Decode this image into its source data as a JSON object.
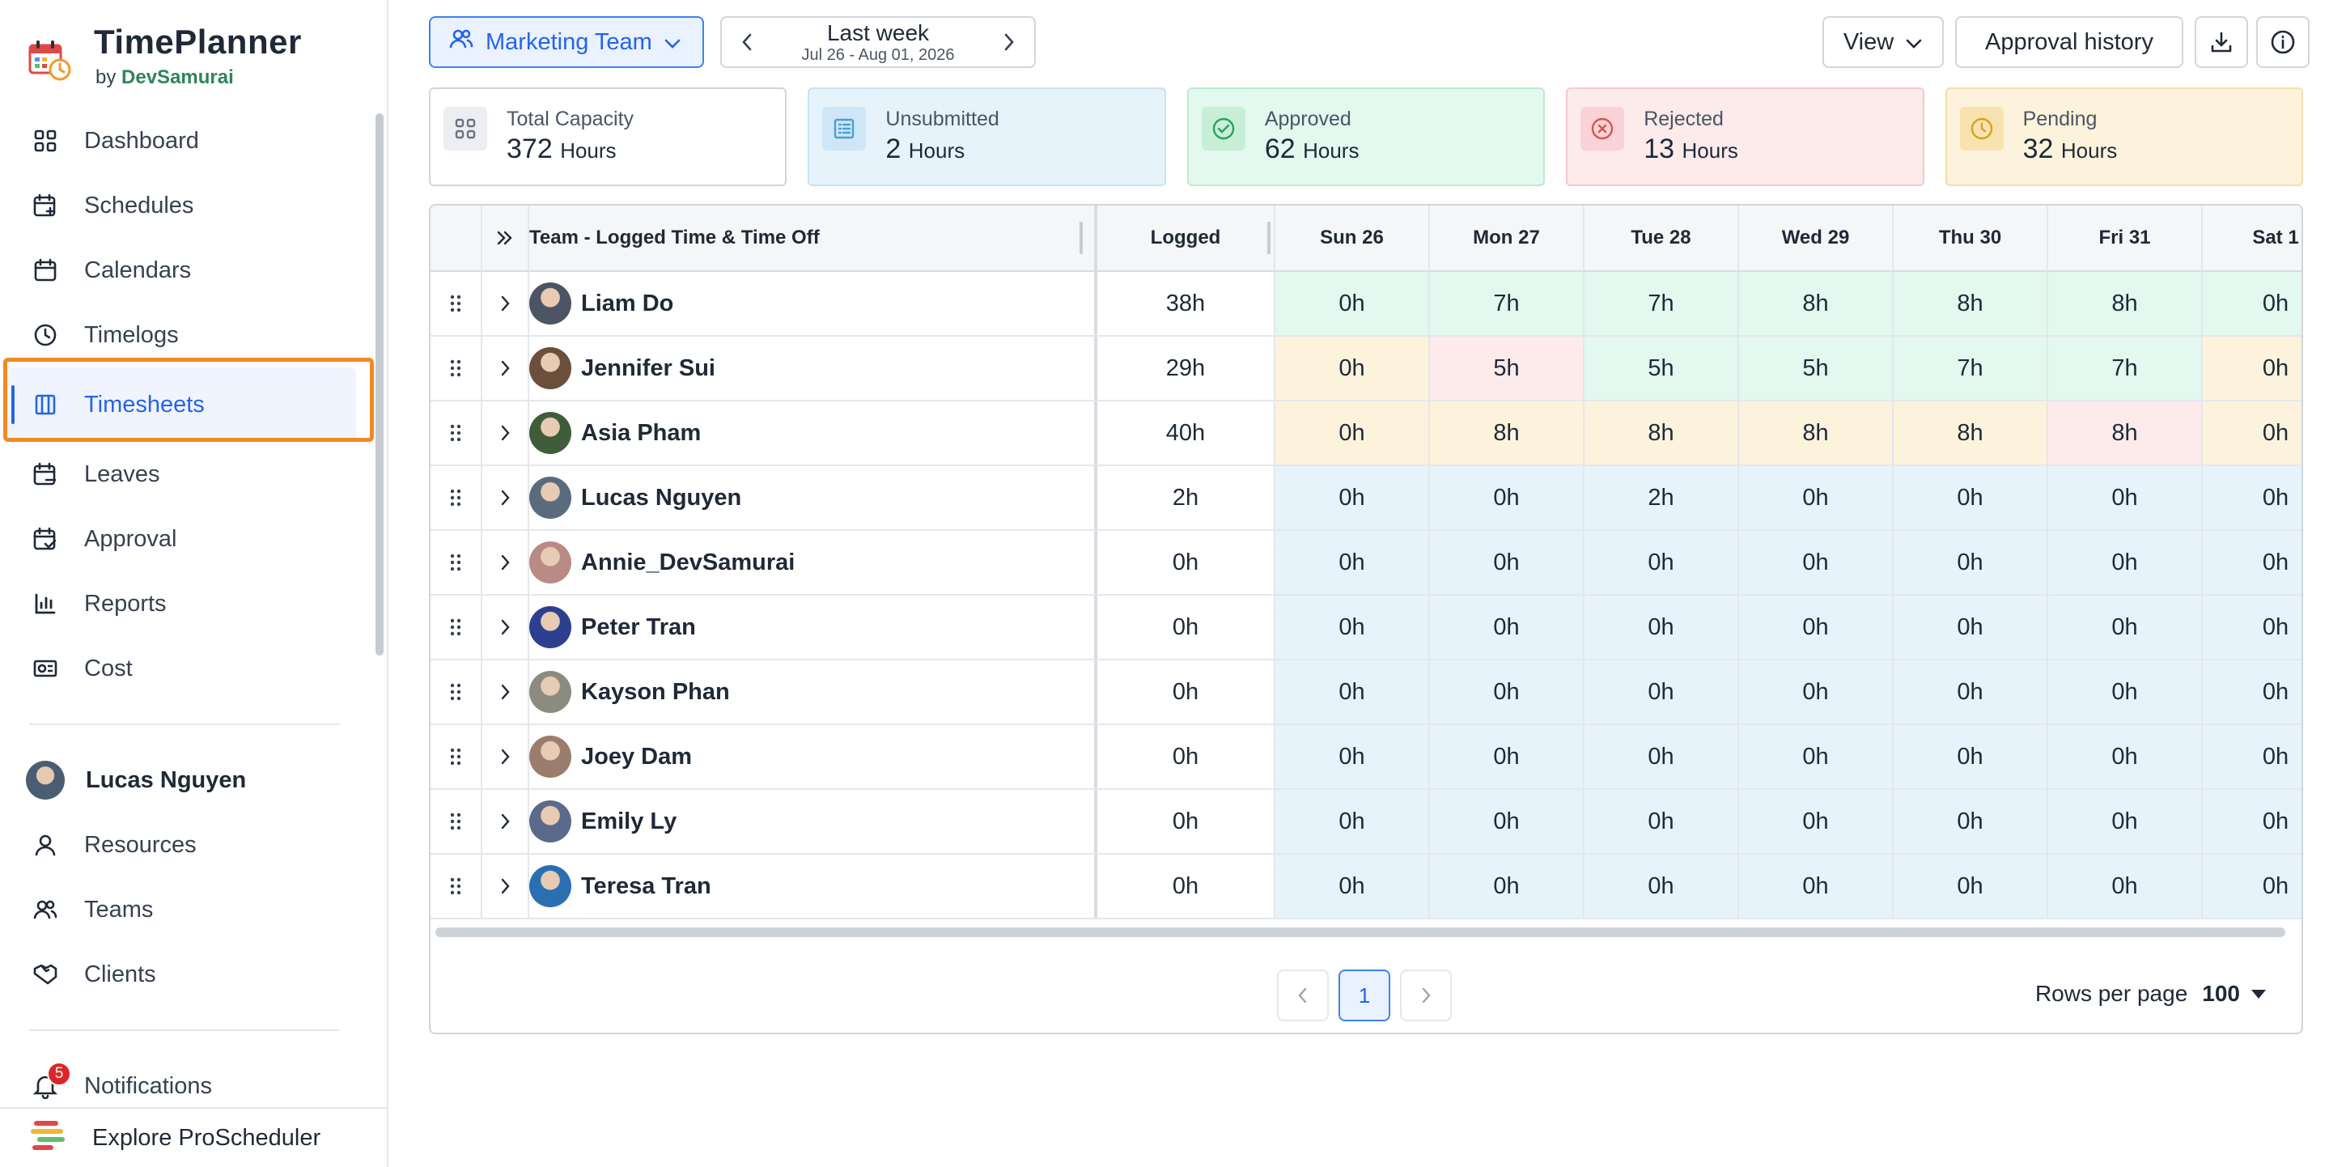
{
  "brand": {
    "title": "TimePlanner",
    "sub_prefix": "by",
    "sub_name": "DevSamurai"
  },
  "nav": [
    {
      "label": "Dashboard",
      "icon": "dashboard-icon"
    },
    {
      "label": "Schedules",
      "icon": "calendar-plus-icon"
    },
    {
      "label": "Calendars",
      "icon": "calendar-icon"
    },
    {
      "label": "Timelogs",
      "icon": "clock-icon"
    },
    {
      "label": "Timesheets",
      "icon": "timesheet-icon",
      "active": true
    },
    {
      "label": "Leaves",
      "icon": "calendar-minus-icon"
    },
    {
      "label": "Approval",
      "icon": "calendar-check-icon"
    },
    {
      "label": "Reports",
      "icon": "bar-chart-icon"
    },
    {
      "label": "Cost",
      "icon": "cost-icon"
    }
  ],
  "user": {
    "name": "Lucas Nguyen"
  },
  "nav2": [
    {
      "label": "Resources",
      "icon": "person-icon"
    },
    {
      "label": "Teams",
      "icon": "team-icon"
    },
    {
      "label": "Clients",
      "icon": "handshake-icon"
    }
  ],
  "notifications": {
    "label": "Notifications",
    "count": "5"
  },
  "explore": {
    "label": "Explore ProScheduler"
  },
  "toolbar": {
    "team": "Marketing Team",
    "week_title": "Last week",
    "week_range": "Jul 26 - Aug 01, 2026",
    "view_label": "View",
    "history_label": "Approval history"
  },
  "stats": {
    "total": {
      "label": "Total Capacity",
      "value": "372",
      "unit": "Hours"
    },
    "unsubmitted": {
      "label": "Unsubmitted",
      "value": "2",
      "unit": "Hours"
    },
    "approved": {
      "label": "Approved",
      "value": "62",
      "unit": "Hours"
    },
    "rejected": {
      "label": "Rejected",
      "value": "13",
      "unit": "Hours"
    },
    "pending": {
      "label": "Pending",
      "value": "32",
      "unit": "Hours"
    }
  },
  "table": {
    "headers": {
      "name": "Team - Logged Time & Time Off",
      "logged": "Logged"
    },
    "days": [
      "Sun 26",
      "Mon 27",
      "Tue 28",
      "Wed 29",
      "Thu 30",
      "Fri 31",
      "Sat 1"
    ],
    "rows": [
      {
        "name": "Liam Do",
        "logged": "38h",
        "hours": [
          "0h",
          "7h",
          "7h",
          "8h",
          "8h",
          "8h",
          "0h"
        ],
        "status": [
          "green",
          "green",
          "green",
          "green",
          "green",
          "green",
          "green"
        ],
        "avatar": "#4b5563"
      },
      {
        "name": "Jennifer Sui",
        "logged": "29h",
        "hours": [
          "0h",
          "5h",
          "5h",
          "5h",
          "7h",
          "7h",
          "0h"
        ],
        "status": [
          "yellow",
          "red",
          "green",
          "green",
          "green",
          "green",
          "yellow"
        ],
        "avatar": "#6b4f3a"
      },
      {
        "name": "Asia Pham",
        "logged": "40h",
        "hours": [
          "0h",
          "8h",
          "8h",
          "8h",
          "8h",
          "8h",
          "0h"
        ],
        "status": [
          "yellow",
          "yellow",
          "yellow",
          "yellow",
          "yellow",
          "red",
          "yellow"
        ],
        "avatar": "#3f5d3a"
      },
      {
        "name": "Lucas Nguyen",
        "logged": "2h",
        "hours": [
          "0h",
          "0h",
          "2h",
          "0h",
          "0h",
          "0h",
          "0h"
        ],
        "status": [
          "blue",
          "blue",
          "blue",
          "blue",
          "blue",
          "blue",
          "blue"
        ],
        "avatar": "#5a6b7d"
      },
      {
        "name": "Annie_DevSamurai",
        "logged": "0h",
        "hours": [
          "0h",
          "0h",
          "0h",
          "0h",
          "0h",
          "0h",
          "0h"
        ],
        "status": [
          "blue",
          "blue",
          "blue",
          "blue",
          "blue",
          "blue",
          "blue"
        ],
        "avatar": "#b98a86"
      },
      {
        "name": "Peter Tran",
        "logged": "0h",
        "hours": [
          "0h",
          "0h",
          "0h",
          "0h",
          "0h",
          "0h",
          "0h"
        ],
        "status": [
          "blue",
          "blue",
          "blue",
          "blue",
          "blue",
          "blue",
          "blue"
        ],
        "avatar": "#2f3f8f"
      },
      {
        "name": "Kayson Phan",
        "logged": "0h",
        "hours": [
          "0h",
          "0h",
          "0h",
          "0h",
          "0h",
          "0h",
          "0h"
        ],
        "status": [
          "blue",
          "blue",
          "blue",
          "blue",
          "blue",
          "blue",
          "blue"
        ],
        "avatar": "#8b8b80"
      },
      {
        "name": "Joey Dam",
        "logged": "0h",
        "hours": [
          "0h",
          "0h",
          "0h",
          "0h",
          "0h",
          "0h",
          "0h"
        ],
        "status": [
          "blue",
          "blue",
          "blue",
          "blue",
          "blue",
          "blue",
          "blue"
        ],
        "avatar": "#9a7d6d"
      },
      {
        "name": "Emily Ly",
        "logged": "0h",
        "hours": [
          "0h",
          "0h",
          "0h",
          "0h",
          "0h",
          "0h",
          "0h"
        ],
        "status": [
          "blue",
          "blue",
          "blue",
          "blue",
          "blue",
          "blue",
          "blue"
        ],
        "avatar": "#5b6a8a"
      },
      {
        "name": "Teresa Tran",
        "logged": "0h",
        "hours": [
          "0h",
          "0h",
          "0h",
          "0h",
          "0h",
          "0h",
          "0h"
        ],
        "status": [
          "blue",
          "blue",
          "blue",
          "blue",
          "blue",
          "blue",
          "blue"
        ],
        "avatar": "#2a6fb0"
      }
    ]
  },
  "pagination": {
    "current": "1",
    "rows_label": "Rows per page",
    "rows_value": "100"
  },
  "colors": {
    "accent": "#2563eb",
    "highlight": "#f08a24",
    "green": "#e3f8ee",
    "red": "#fdebec",
    "yellow": "#fdf3dc",
    "blue": "#e6f3fb"
  }
}
